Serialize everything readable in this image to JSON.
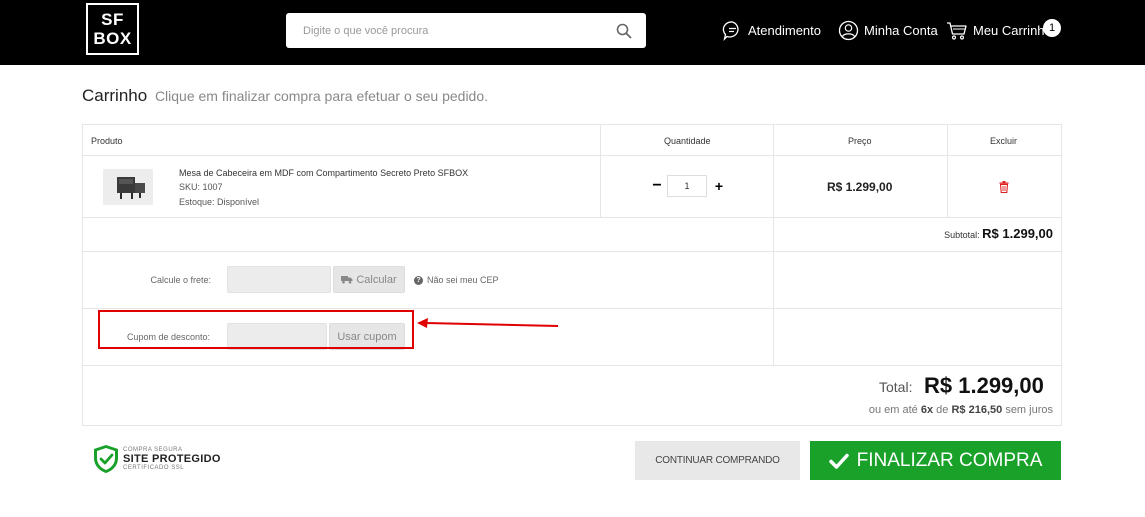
{
  "header": {
    "logo_line1": "SF",
    "logo_line2": "BOX",
    "search_placeholder": "Digite o que você procura",
    "nav_atendimento": "Atendimento",
    "nav_minha_conta": "Minha Conta",
    "nav_carrinho": "Meu Carrinho",
    "cart_count": "1"
  },
  "page": {
    "title": "Carrinho",
    "subtitle": "Clique em finalizar compra para efetuar o seu pedido."
  },
  "table": {
    "col_produto": "Produto",
    "col_quantidade": "Quantidade",
    "col_preco": "Preço",
    "col_excluir": "Excluir"
  },
  "item": {
    "name": "Mesa de Cabeceira em MDF com Compartimento Secreto Preto SFBOX",
    "sku": "SKU: 1007",
    "stock": "Estoque: Disponível",
    "quantity": "1",
    "price": "R$ 1.299,00"
  },
  "subtotal": {
    "label": "Subtotal:",
    "value": "R$ 1.299,00"
  },
  "shipping": {
    "label": "Calcule o frete:",
    "button": "Calcular",
    "help": "Não sei meu CEP"
  },
  "coupon": {
    "label": "Cupom de desconto:",
    "button": "Usar cupom"
  },
  "total": {
    "label": "Total:",
    "value": "R$ 1.299,00",
    "installments_prefix": "ou em até",
    "installments_count": "6x",
    "installments_mid": "de",
    "installments_value": "R$ 216,50",
    "installments_suffix": "sem juros"
  },
  "seal": {
    "top": "COMPRA SEGURA",
    "main": "SITE PROTEGIDO",
    "bottom": "CERTIFICADO SSL"
  },
  "actions": {
    "continue": "CONTINUAR COMPRANDO",
    "finalize": "FINALIZAR COMPRA"
  },
  "colors": {
    "header_bg": "#000000",
    "finalize_green": "#1aa12a",
    "trash_red": "#e02020",
    "annotation_red": "#e00000"
  }
}
